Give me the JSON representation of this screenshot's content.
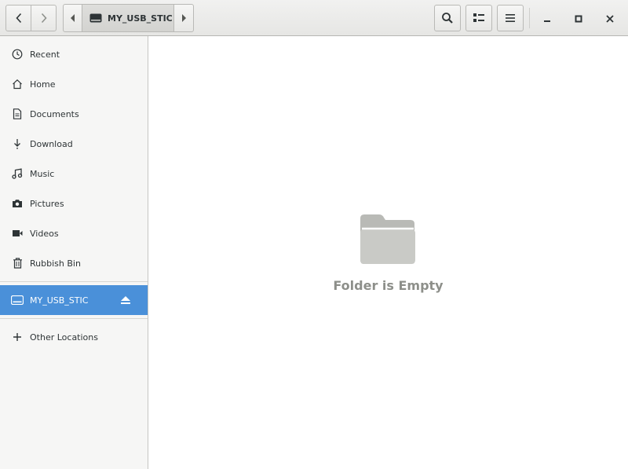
{
  "header": {
    "path_crumb": "MY_USB_STIC",
    "icons": {
      "back": "chevron-left-icon",
      "forward": "chevron-right-icon",
      "search": "search-icon",
      "view": "list-view-icon",
      "menu": "hamburger-menu-icon",
      "minimize": "minimize-icon",
      "maximize": "maximize-icon",
      "close": "close-icon"
    }
  },
  "sidebar": {
    "places": [
      {
        "label": "Recent",
        "icon": "clock-icon"
      },
      {
        "label": "Home",
        "icon": "home-icon"
      },
      {
        "label": "Documents",
        "icon": "document-icon"
      },
      {
        "label": "Download",
        "icon": "download-icon"
      },
      {
        "label": "Music",
        "icon": "music-icon"
      },
      {
        "label": "Pictures",
        "icon": "camera-icon"
      },
      {
        "label": "Videos",
        "icon": "video-icon"
      },
      {
        "label": "Rubbish Bin",
        "icon": "trash-icon"
      }
    ],
    "device": {
      "label": "MY_USB_STIC",
      "icon": "drive-icon",
      "action_icon": "eject-icon"
    },
    "other": {
      "label": "Other Locations",
      "icon": "plus-icon"
    }
  },
  "main": {
    "empty_message": "Folder is Empty",
    "empty_icon": "folder-icon"
  },
  "colors": {
    "accent": "#4a90d9",
    "muted_text": "#8d8f8a",
    "folder_gray": "#b9bab6"
  }
}
